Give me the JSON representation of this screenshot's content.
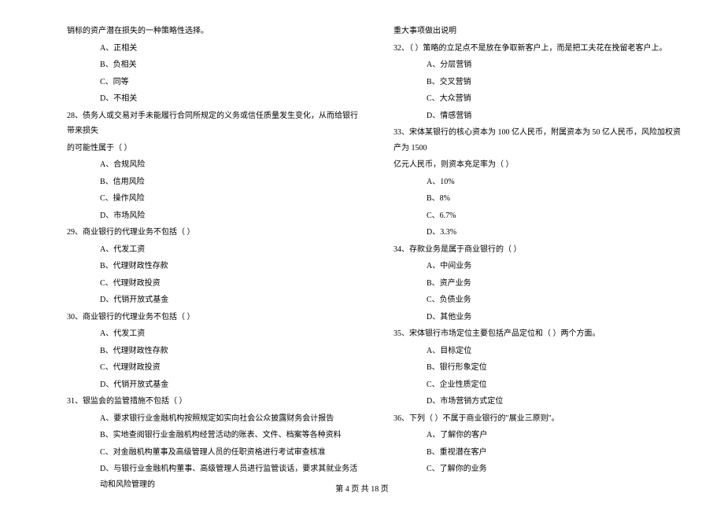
{
  "left_column": {
    "intro_line": "销标的资产潜在损失的一种策略性选择。",
    "q27_options": [
      "A、正相关",
      "B、负相关",
      "C、同等",
      "D、不相关"
    ],
    "q28": {
      "text": "28、债务人或交易对手未能履行合同所规定的义务或信任质量发生变化，从而给银行带来损失",
      "text2": "的可能性属于（    ）",
      "options": [
        "A、合规风险",
        "B、信用风险",
        "C、操作风险",
        "D、市场风险"
      ]
    },
    "q29": {
      "text": "29、商业银行的代理业务不包括（    ）",
      "options": [
        "A、代发工资",
        "B、代理财政性存款",
        "C、代理财政投资",
        "D、代销开放式基金"
      ]
    },
    "q30": {
      "text": "30、商业银行的代理业务不包括（    ）",
      "options": [
        "A、代发工资",
        "B、代理财政性存款",
        "C、代理财政投资",
        "D、代销开放式基金"
      ]
    },
    "q31": {
      "text": "31、银监会的监管措施不包括（    ）",
      "options": [
        "A、要求银行业金融机构按照规定如实向社会公众披露财务会计报告",
        "B、实地查阅银行业金融机构经营活动的账表、文件、档案等各种资料",
        "C、对金融机构董事及高级管理人员的任职资格进行考试审查核准",
        "D、与银行业金融机构董事、高级管理人员进行监管谈话，要求其就业务活动和风险管理的"
      ]
    }
  },
  "right_column": {
    "intro_line": "重大事项做出说明",
    "q32": {
      "text": "32、（    ）策略的立足点不是放在争取新客户上，而是把工夫花在挽留老客户上。",
      "options": [
        "A、分层营销",
        "B、交叉营销",
        "C、大众营销",
        "D、情感营销"
      ]
    },
    "q33": {
      "text": "33、宋体某银行的核心资本为 100 亿人民币，附属资本为 50 亿人民币，风险加权资产为 1500",
      "text2": "亿元人民币，则资本充足率为（    ）",
      "options": [
        "A、10%",
        "B、8%",
        "C、6.7%",
        "D、3.3%"
      ]
    },
    "q34": {
      "text": "34、存款业务是属于商业银行的（    ）",
      "options": [
        "A、中间业务",
        "B、资产业务",
        "C、负债业务",
        "D、其他业务"
      ]
    },
    "q35": {
      "text": "35、宋体银行市场定位主要包括产品定位和（    ）两个方面。",
      "options": [
        "A、目标定位",
        "B、银行形象定位",
        "C、企业性质定位",
        "D、市场营销方式定位"
      ]
    },
    "q36": {
      "text": "36、下列（    ）不属于商业银行的\"展业三原则\"。",
      "options": [
        "A、了解你的客户",
        "B、重视潜在客户",
        "C、了解你的业务"
      ]
    }
  },
  "footer": "第 4 页 共 18 页"
}
